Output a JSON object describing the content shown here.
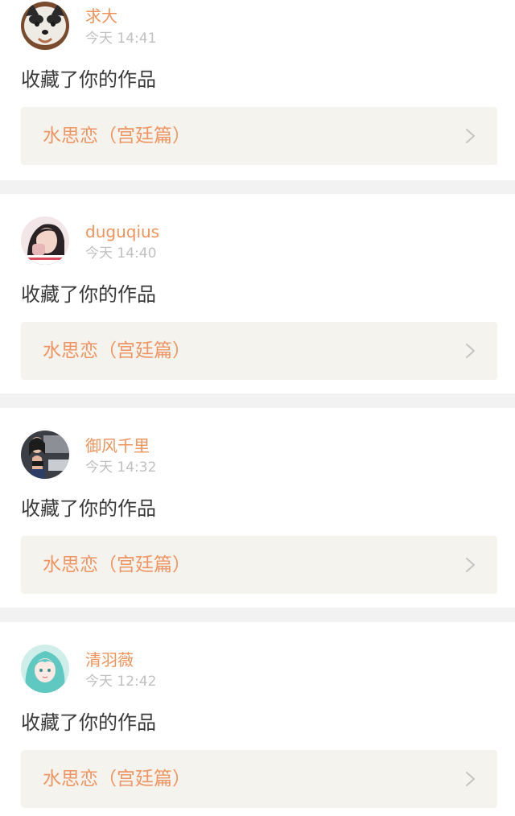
{
  "notifications": [
    {
      "username": "求大",
      "time": "今天 14:41",
      "action": "收藏了你的作品",
      "work_title": "水思恋（宫廷篇）",
      "avatar": "husky-dog-avatar"
    },
    {
      "username": "duguqius",
      "time": "今天 14:40",
      "action": "收藏了你的作品",
      "work_title": "水思恋（宫廷篇）",
      "avatar": "girl-selfie-avatar"
    },
    {
      "username": "御风千里",
      "time": "今天 14:32",
      "action": "收藏了你的作品",
      "work_title": "水思恋（宫廷篇）",
      "avatar": "woman-car-avatar"
    },
    {
      "username": "清羽薇",
      "time": "今天 12:42",
      "action": "收藏了你的作品",
      "work_title": "水思恋（宫廷篇）",
      "avatar": "anime-girl-avatar"
    }
  ],
  "colors": {
    "accent": "#f0935a",
    "work_bg": "#f4f3ed",
    "separator": "#f2f2f2"
  }
}
